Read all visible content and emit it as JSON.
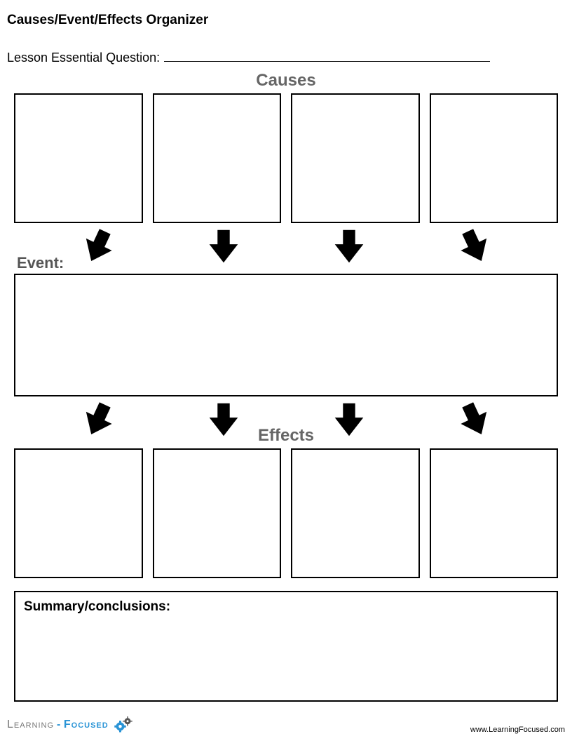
{
  "title": "Causes/Event/Effects Organizer",
  "question_label": "Lesson Essential Question:",
  "headings": {
    "causes": "Causes",
    "event": "Event:",
    "effects": "Effects"
  },
  "summary_label": "Summary/conclusions:",
  "logo": {
    "part1": "Learning",
    "dash": "-",
    "part2": "Focused"
  },
  "url": "www.LearningFocused.com"
}
